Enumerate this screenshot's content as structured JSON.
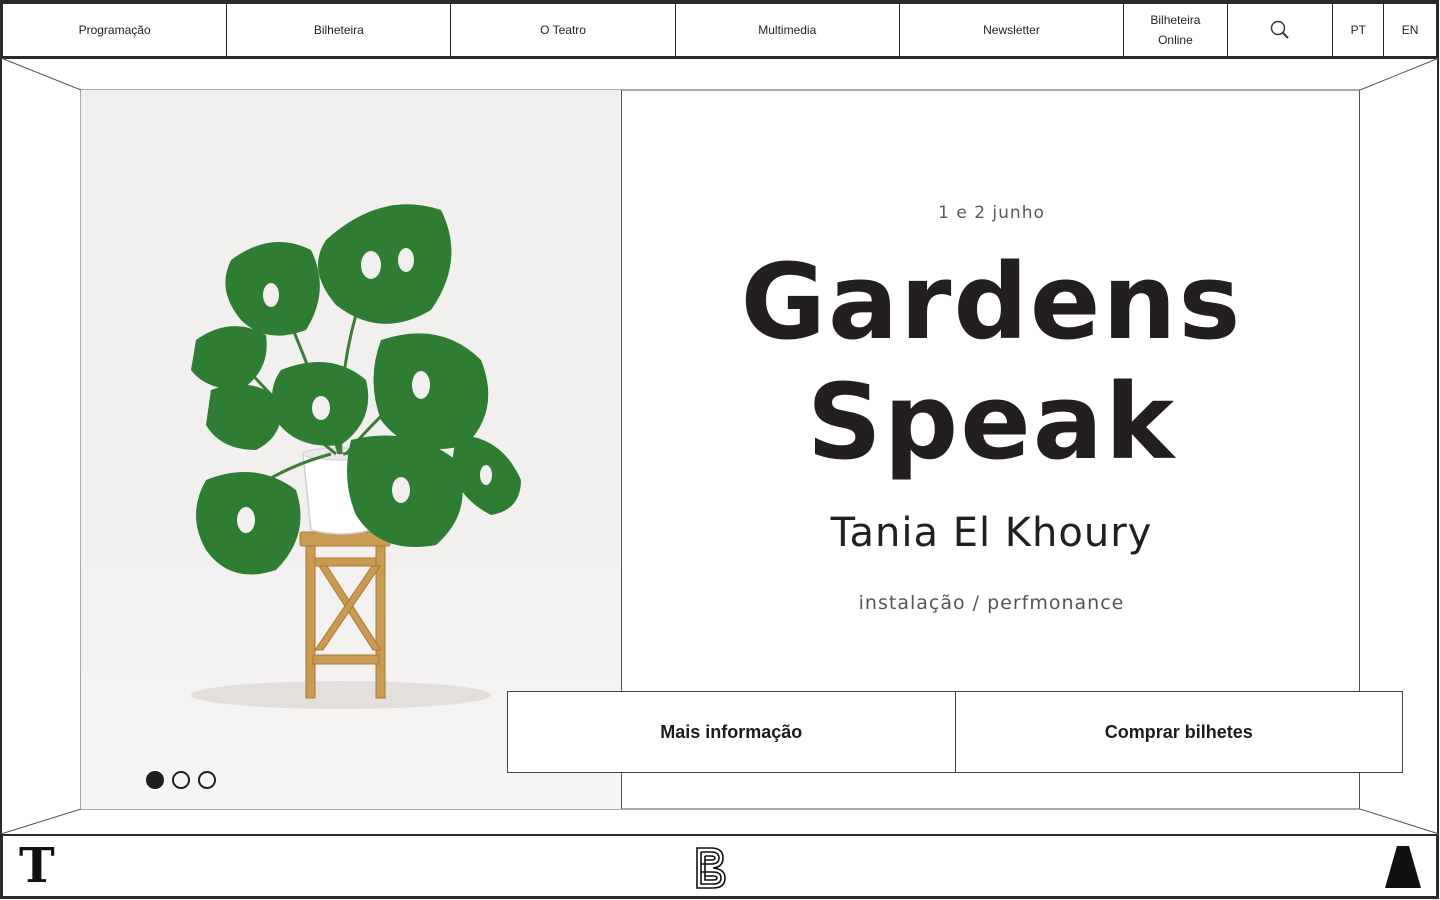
{
  "nav": {
    "items": [
      {
        "label": "Programação"
      },
      {
        "label": "Bilheteira"
      },
      {
        "label": "O Teatro"
      },
      {
        "label": "Multimedia"
      },
      {
        "label": "Newsletter"
      },
      {
        "label": "Bilheteira\nOnline"
      }
    ],
    "search_icon": "search-icon",
    "lang_pt": "PT",
    "lang_en": "EN"
  },
  "hero": {
    "date": "1 e 2 junho",
    "title": "Gardens\nSpeak",
    "artist": "Tania El Khoury",
    "genre": "instalação / perfmonance",
    "image": "monstera-plant-on-wooden-stool",
    "slides": {
      "count": 3,
      "active": 1
    }
  },
  "actions": {
    "more_info": "Mais informação",
    "buy_tickets": "Comprar bilhetes"
  },
  "footer": {
    "left_logo": "T",
    "center_logo": "b-monogram-logo",
    "right_logo": "triangle-logo"
  },
  "colors": {
    "text": "#231f20",
    "plant": "#2e7d32",
    "stool": "#c99a52",
    "image_bg": "#f2f0ef"
  }
}
